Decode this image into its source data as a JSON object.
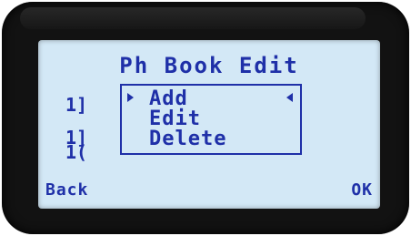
{
  "screen": {
    "title": "Ph Book Edit",
    "background_entries": [
      "1]",
      "1]",
      "1("
    ],
    "menu": {
      "items": [
        "Add",
        "Edit",
        "Delete"
      ],
      "selected": "Add"
    },
    "softkeys": {
      "left": "Back",
      "right": "OK"
    }
  },
  "colors": {
    "text": "#1f30a8",
    "screen_bg": "#d3e8f6",
    "bezel": "#121212"
  }
}
